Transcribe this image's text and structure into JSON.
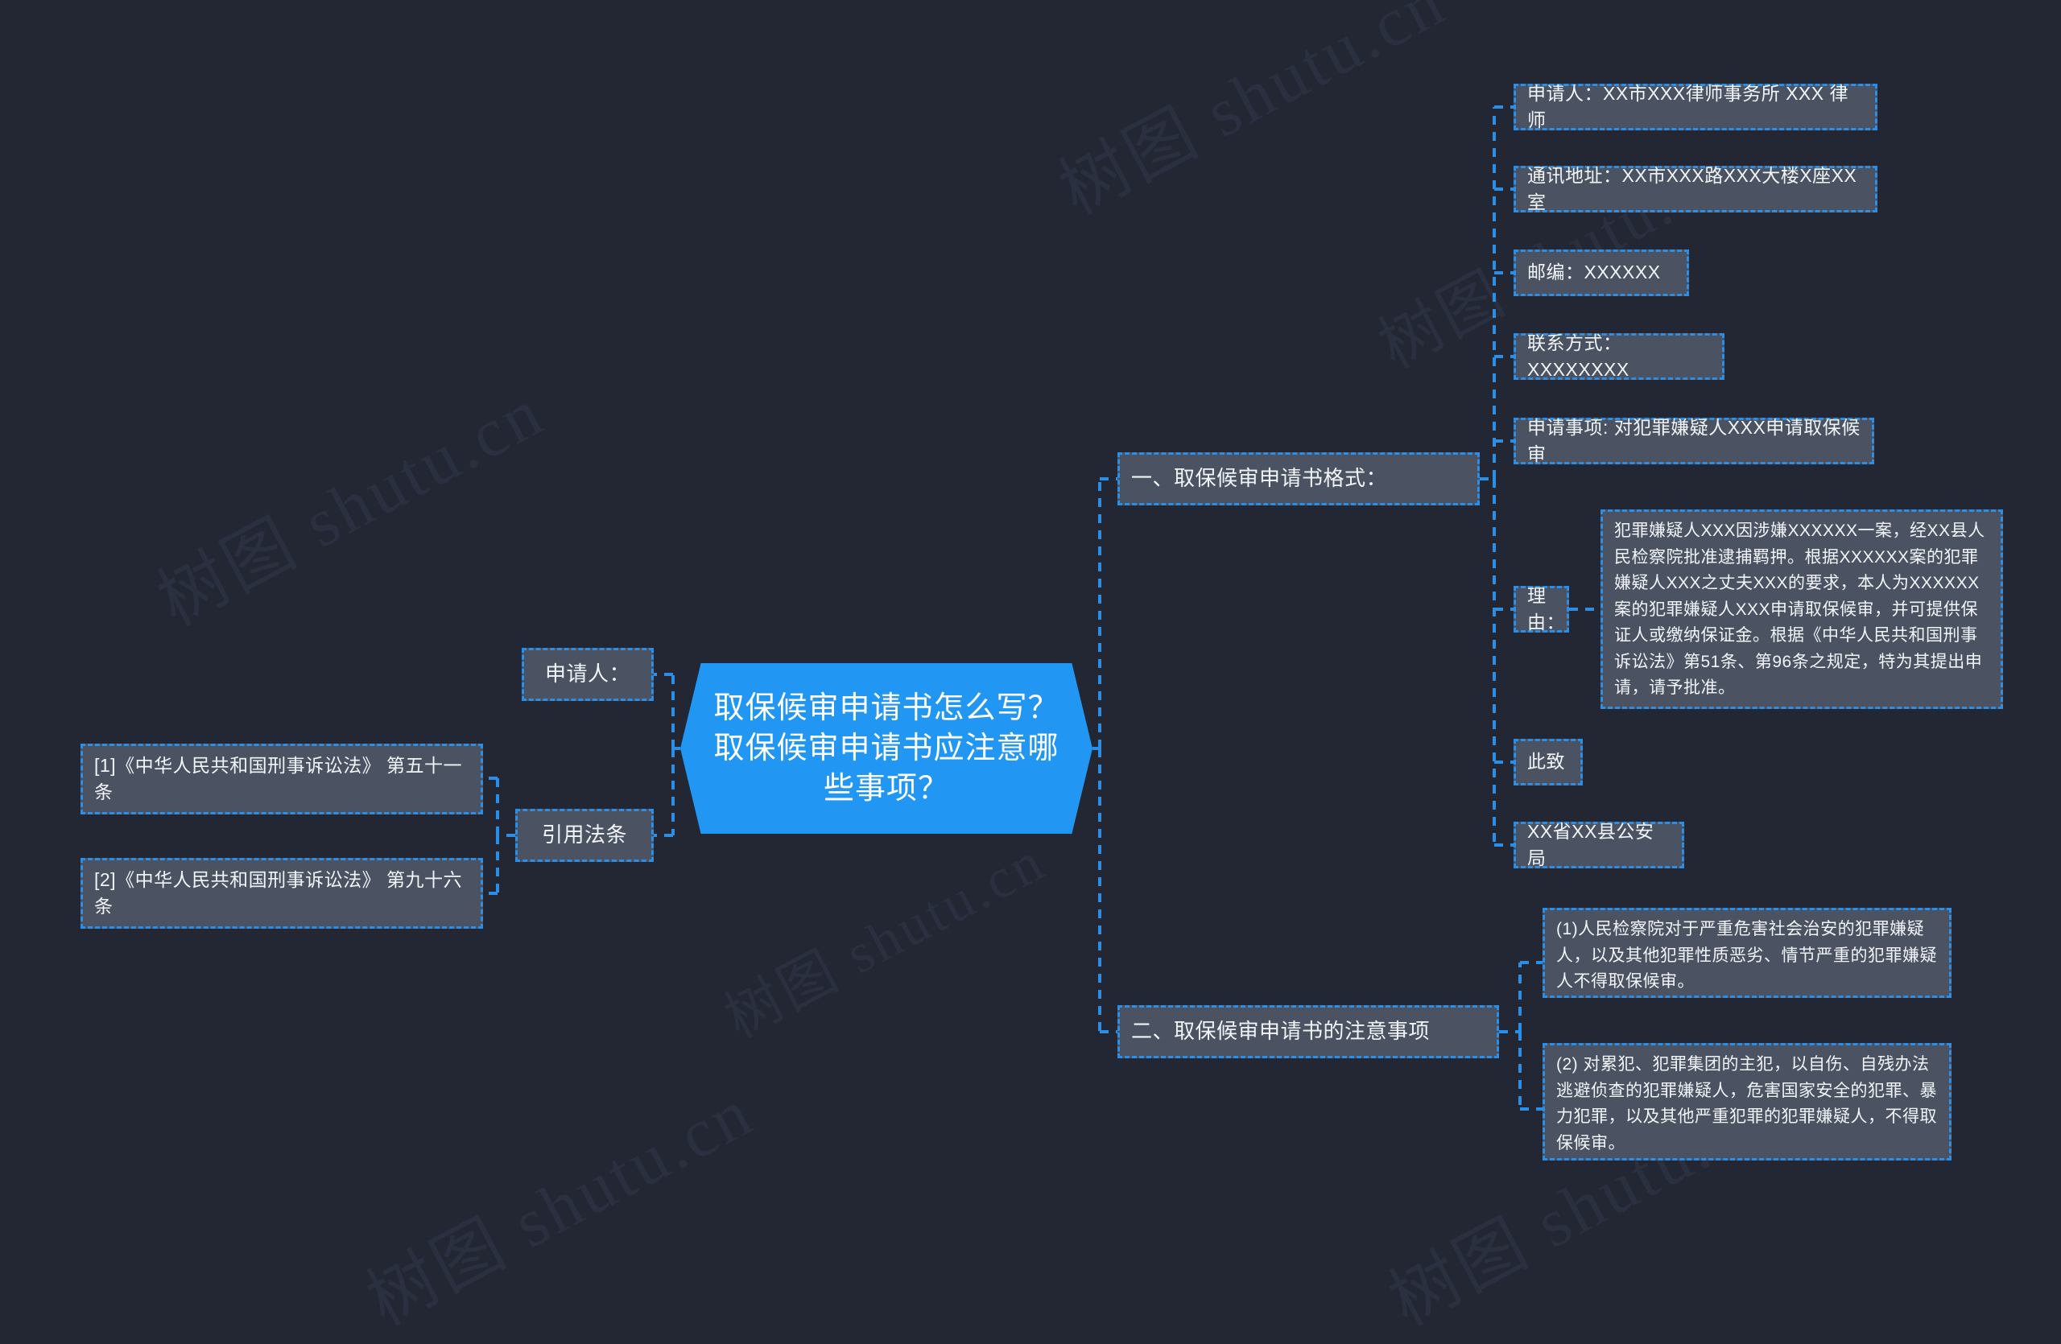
{
  "meta": {
    "watermark_text": "树图 shutu.cn",
    "background_color": "#222733",
    "node_fill_color": "#4b5362",
    "node_border_color": "#2b8fe8",
    "root_fill_color": "#2196f3",
    "text_color": "#f2f5f8"
  },
  "root": {
    "label": "取保候审申请书怎么写？取保候审申请书应注意哪些事项？"
  },
  "left_branches": [
    {
      "label": "申请人：",
      "children": []
    },
    {
      "label": "引用法条",
      "children": [
        {
          "label": "[1]《中华人民共和国刑事诉讼法》 第五十一条"
        },
        {
          "label": "[2]《中华人民共和国刑事诉讼法》 第九十六条"
        }
      ]
    }
  ],
  "right_branches": [
    {
      "label": "一、取保候审申请书格式：",
      "children": [
        {
          "label": "申请人：XX市XXX律师事务所 XXX 律师"
        },
        {
          "label": "通讯地址：XX市XXX路XXX大楼X座XX室"
        },
        {
          "label": "邮编：XXXXXX"
        },
        {
          "label": "联系方式：XXXXXXXX"
        },
        {
          "label": "申请事项: 对犯罪嫌疑人XXX申请取保候审"
        },
        {
          "label": "理由：",
          "children": [
            {
              "label": "犯罪嫌疑人XXX因涉嫌XXXXXX一案，经XX县人民检察院批准逮捕羁押。根据XXXXXX案的犯罪嫌疑人XXX之丈夫XXX的要求，本人为XXXXXX案的犯罪嫌疑人XXX申请取保候审，并可提供保证人或缴纳保证金。根据《中华人民共和国刑事诉讼法》第51条、第96条之规定，特为其提出申请，请予批准。"
            }
          ]
        },
        {
          "label": "此致"
        },
        {
          "label": "XX省XX县公安局"
        }
      ]
    },
    {
      "label": "二、取保候审申请书的注意事项",
      "children": [
        {
          "label": "(1)人民检察院对于严重危害社会治安的犯罪嫌疑人，以及其他犯罪性质恶劣、情节严重的犯罪嫌疑人不得取保候审。"
        },
        {
          "label": "(2) 对累犯、犯罪集团的主犯，以自伤、自残办法逃避侦查的犯罪嫌疑人，危害国家安全的犯罪、暴力犯罪，以及其他严重犯罪的犯罪嫌疑人，不得取保候审。"
        }
      ]
    }
  ]
}
